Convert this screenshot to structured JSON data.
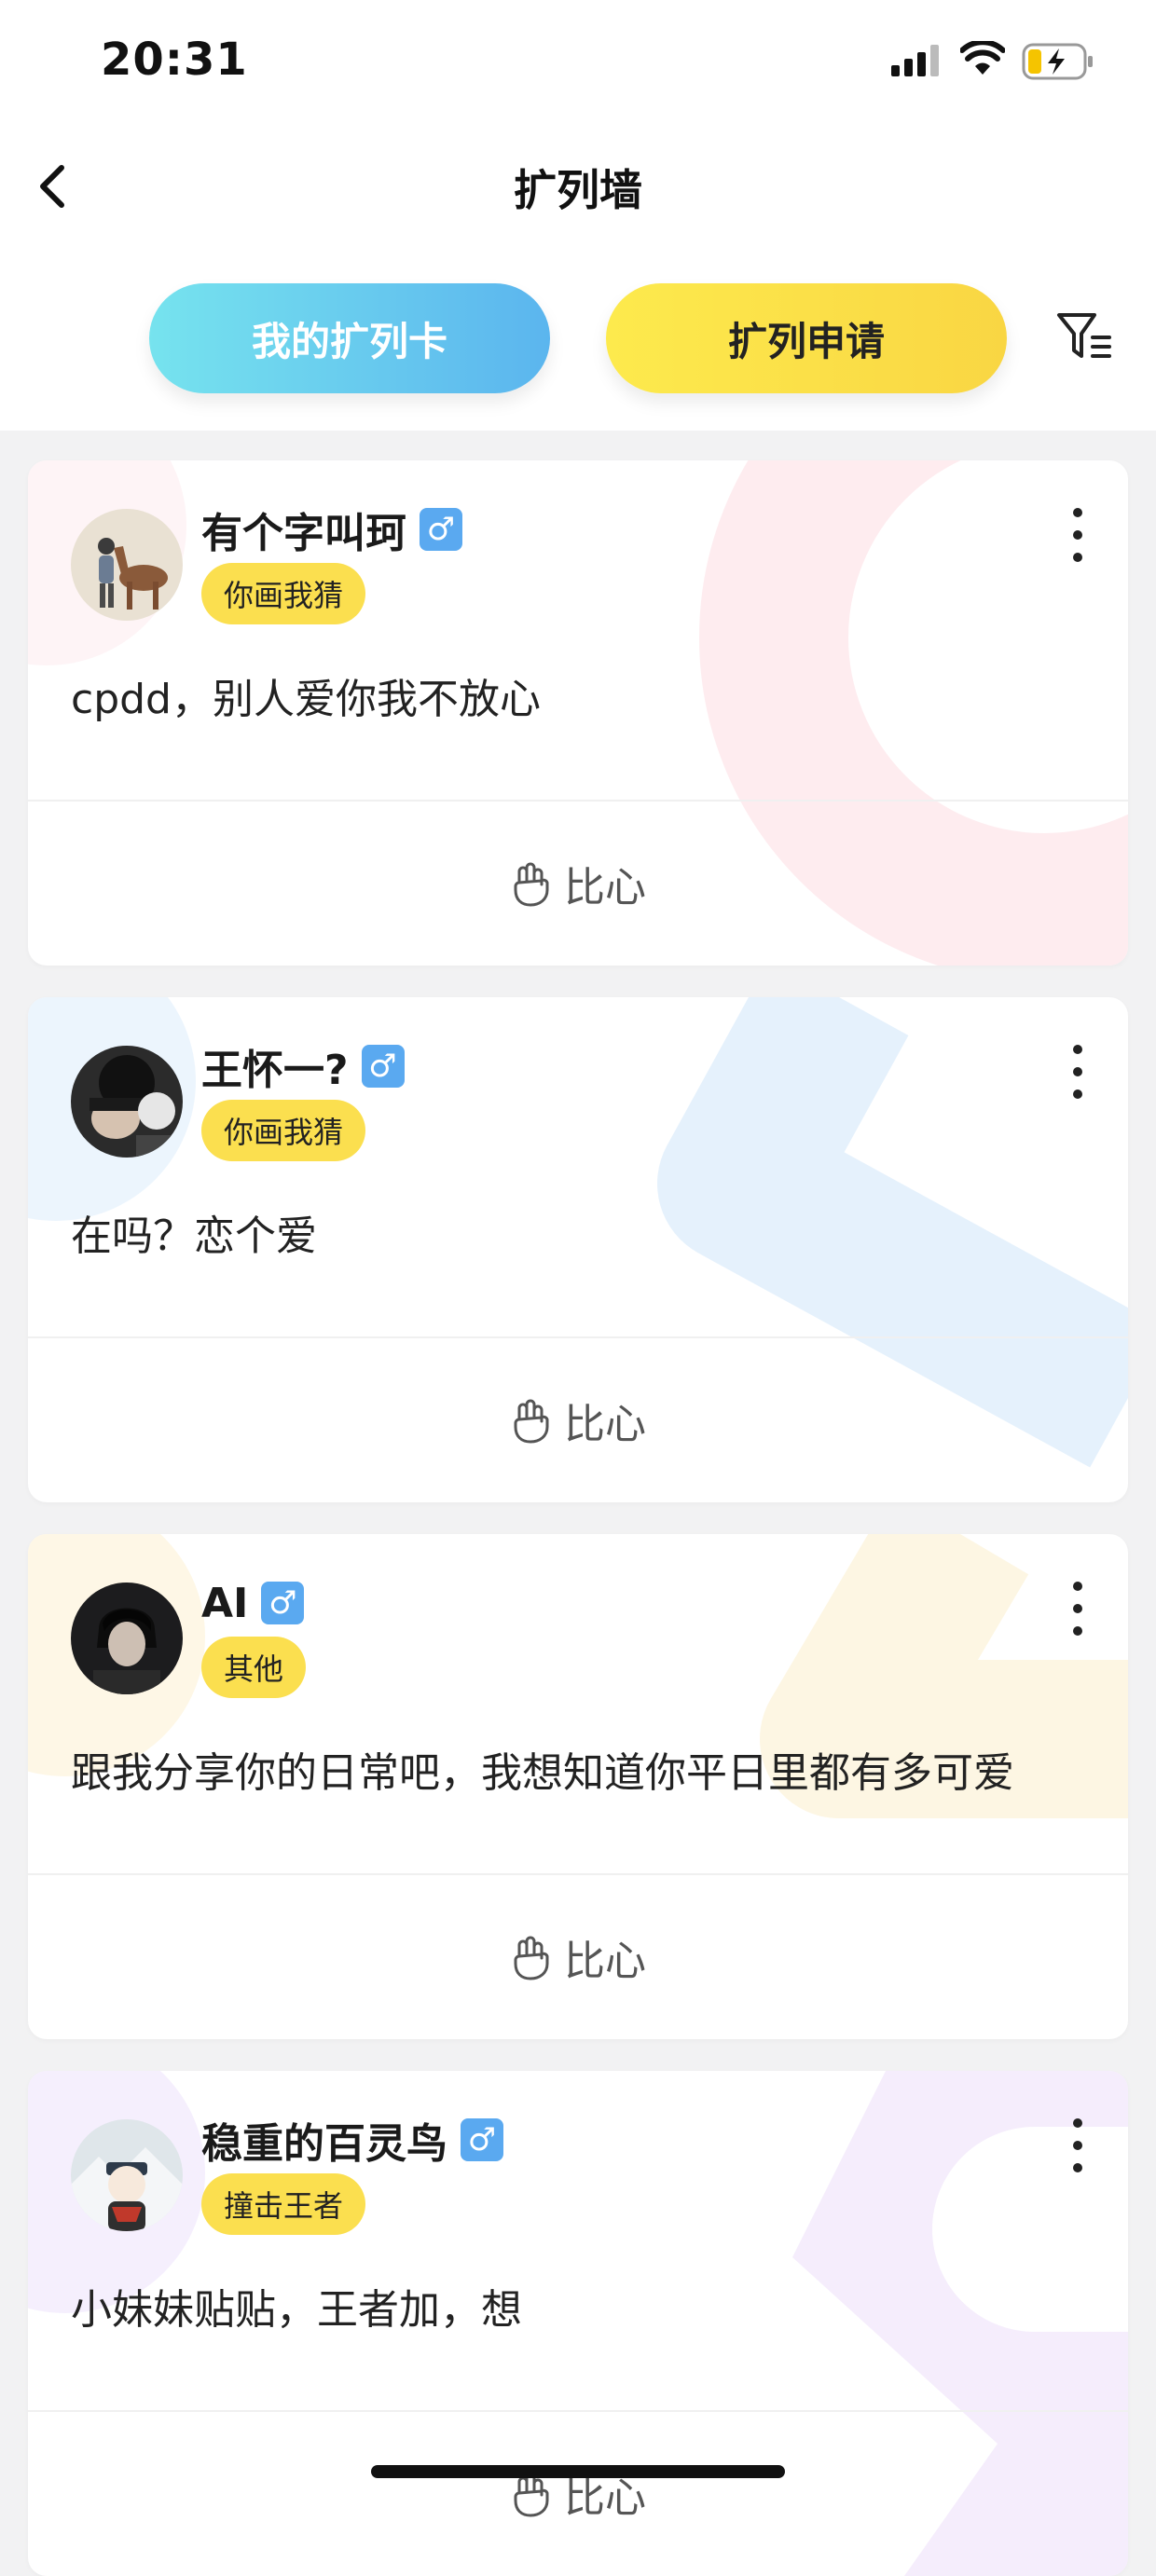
{
  "status_bar": {
    "time": "20:31"
  },
  "nav": {
    "title": "扩列墙"
  },
  "tabs": [
    {
      "label": "我的扩列卡"
    },
    {
      "label": "扩列申请"
    }
  ],
  "icons": {
    "back": "back-chevron-icon",
    "filter": "filter-icon",
    "more": "more-vertical-icon",
    "like": "finger-heart-icon",
    "gender": "male-icon"
  },
  "colors": {
    "tab_mine_start": "#76e3ee",
    "tab_mine_end": "#5bb5ee",
    "tab_apply": "#fbdf4f",
    "tag": "#fbdf4f",
    "gender_badge": "#5aa9f0"
  },
  "cards": [
    {
      "name": "有个字叫珂",
      "gender": "♂",
      "tag": "你画我猜",
      "message": "cpdd，别人爱你我不放心",
      "like_label": "比心"
    },
    {
      "name": "王怀一?",
      "gender": "♂",
      "tag": "你画我猜",
      "message": "在吗？恋个爱",
      "like_label": "比心"
    },
    {
      "name": "AI",
      "gender": "♂",
      "tag": "其他",
      "message": "跟我分享你的日常吧，我想知道你平日里都有多可爱",
      "like_label": "比心"
    },
    {
      "name": "稳重的百灵鸟",
      "gender": "♂",
      "tag": "撞击王者",
      "message": "小妹妹贴贴，王者加，想",
      "like_label": "比心"
    }
  ]
}
